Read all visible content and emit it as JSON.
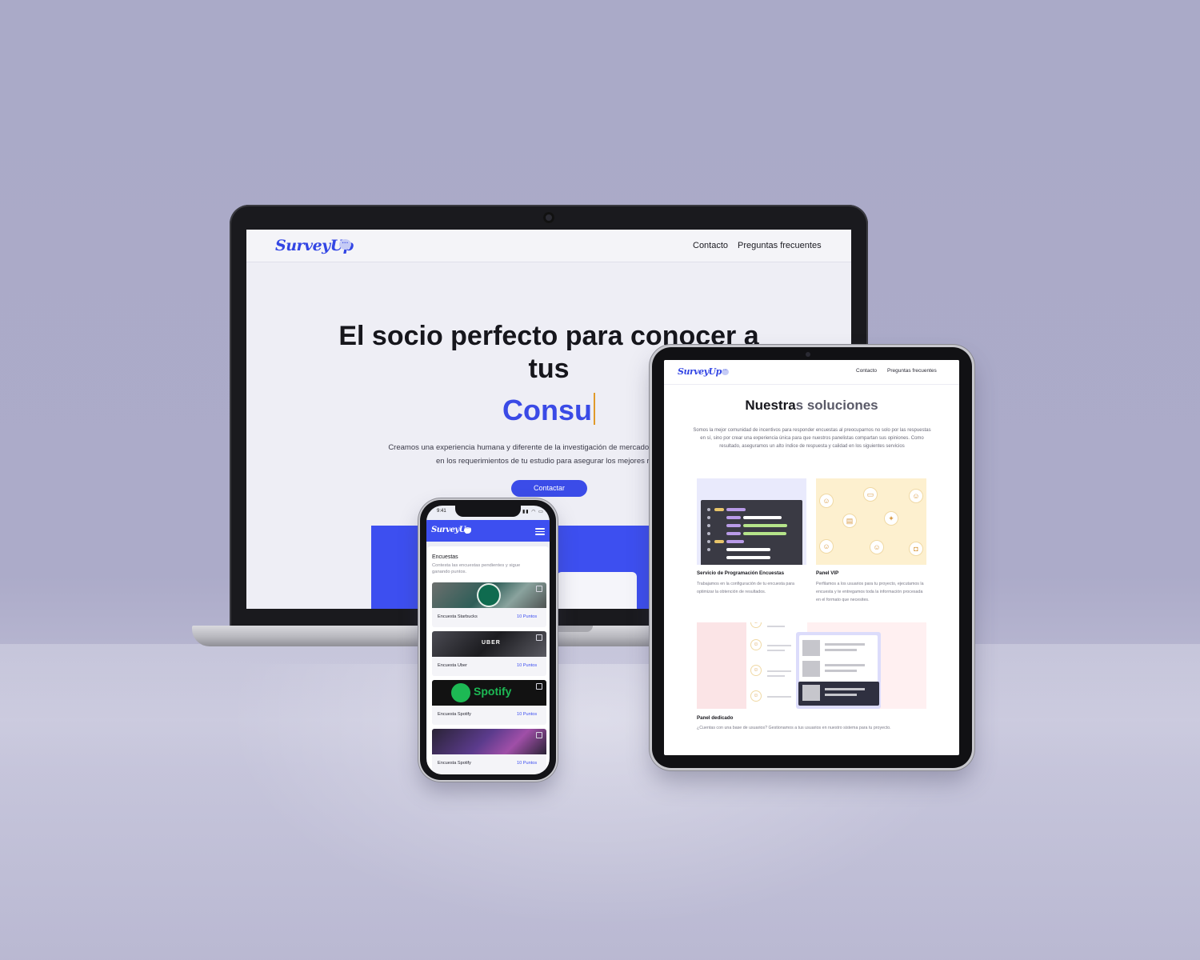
{
  "brand": {
    "logo_text": "SurveyUp",
    "accent": "#3d4ff0"
  },
  "laptop": {
    "nav": [
      "Contacto",
      "Preguntas frecuentes"
    ],
    "hero_title": "El socio perfecto para conocer a tus",
    "hero_typed": "Consu",
    "hero_desc_line1": "Creamos una experiencia humana y diferente de la investigación de mercado en línea, reclutan",
    "hero_desc_line2": "en los requerimientos de tu estudio para asegurar los mejores resu",
    "cta_label": "Contactar"
  },
  "tablet": {
    "nav": [
      "Contacto",
      "Preguntas frecuentes"
    ],
    "section_title_main": "Nuestra",
    "section_title_rest": "s soluciones",
    "intro": "Somos la mejor comunidad de incentivos para responder encuestas al preocuparnos no solo por las respuestas en sí, sino por crear una experiencia única para que nuestros panelistas compartan sus opiniones. Como resultado, aseguramos un alto índice de respuesta y calidad en los siguientes servicios",
    "cards": [
      {
        "title": "Servicio de Programación Encuestas",
        "text": "Trabajamos en la configuración de tu encuesta para optimizar la obtención de resultados."
      },
      {
        "title": "Panel VIP",
        "text": "Perfilamos a los usuarios para tu proyecto, ejecutamos la encuesta y te entregamos toda la información procesada en el formato que necesites."
      },
      {
        "title": "Panel dedicado",
        "text": "¿Cuentas con una base de usuarios? Gestionamos a tus usuarios en nuestro sistema para tu proyecto."
      }
    ]
  },
  "phone": {
    "time": "9:41",
    "heading": "Encuestas",
    "subheading": "Contesta las encuestas pendientes y sigue ganando puntos.",
    "surveys": [
      {
        "name": "Encuesta Starbucks",
        "points": "10 Puntos",
        "image": "starbucks-image",
        "color": "#2f5e58"
      },
      {
        "name": "Encuesta Uber",
        "points": "10 Puntos",
        "image": "uber-image",
        "color": "#2a2a2e"
      },
      {
        "name": "Encuesta Spotify",
        "points": "10 Puntos",
        "image": "spotify-image",
        "color": "#121212"
      },
      {
        "name": "Encuesta Spotify",
        "points": "10 Puntos",
        "image": "card-image",
        "color": "#3a2a5a"
      }
    ],
    "uber_mark": "UBER",
    "spotify_mark": "Spotify"
  }
}
